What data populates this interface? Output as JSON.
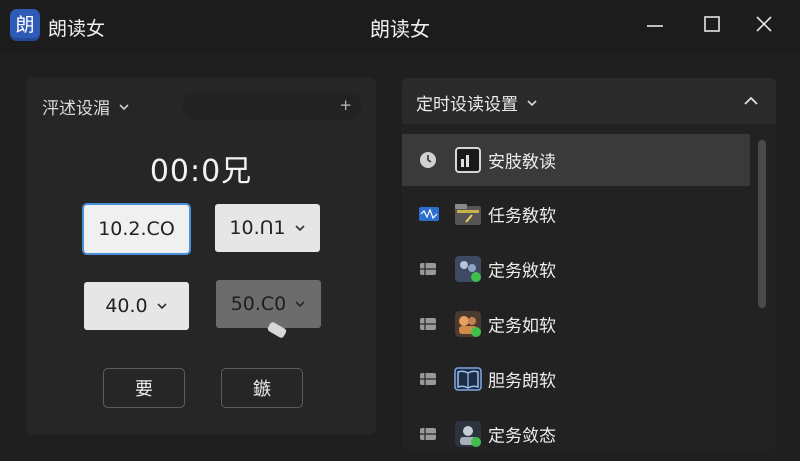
{
  "app": {
    "icon_glyph": "朗",
    "name": "朗读女",
    "window_title": "朗读女"
  },
  "left_panel": {
    "header_label": "泙述设湄",
    "add_glyph": "+",
    "timer": "00:0兄",
    "fields": [
      {
        "value": "10.2.CO",
        "state": "selected"
      },
      {
        "value": "10.Ո1",
        "state": "normal"
      },
      {
        "value": "40.0",
        "state": "normal"
      },
      {
        "value": "50.C0",
        "state": "disabled"
      }
    ],
    "buttons": {
      "primary": "要",
      "secondary": "鏃"
    }
  },
  "right_panel": {
    "header_label": "定时设读设置",
    "items": [
      {
        "label": "安肢敎读",
        "lead_icon": "clock-icon",
        "thumb_icon": "audio-file-icon",
        "active": true
      },
      {
        "label": "任务敎软",
        "lead_icon": "audio-track-icon",
        "thumb_icon": "folder-icon",
        "active": false
      },
      {
        "label": "定务敓软",
        "lead_icon": "list-icon",
        "thumb_icon": "people-icon",
        "active": false
      },
      {
        "label": "定务如软",
        "lead_icon": "list-icon",
        "thumb_icon": "users-icon",
        "active": false
      },
      {
        "label": "胆务朗软",
        "lead_icon": "list-icon",
        "thumb_icon": "book-icon",
        "active": false
      },
      {
        "label": "定务敛态",
        "lead_icon": "list-icon",
        "thumb_icon": "user-status-icon",
        "active": false
      }
    ]
  },
  "colors": {
    "accent": "#4a8fd8",
    "app_icon": "#2f5bb8",
    "status_green": "#3fbf4a",
    "background": "#1f1f1f"
  }
}
